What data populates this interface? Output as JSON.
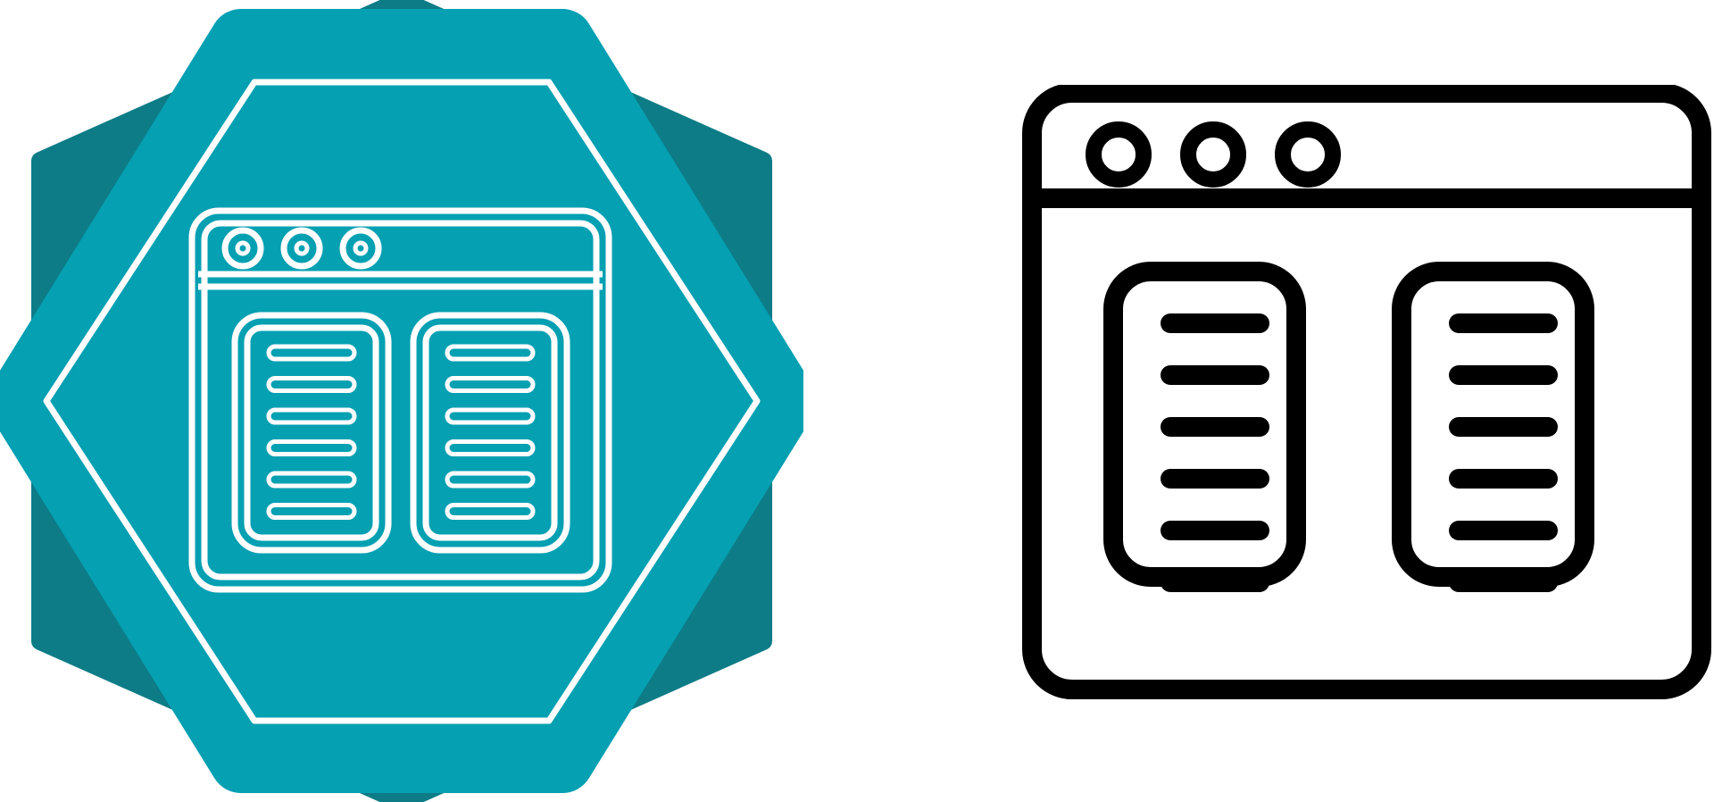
{
  "icons": [
    {
      "name": "browser-two-columns-icon",
      "style": "badge",
      "colors": {
        "badge_light": "#05a0b2",
        "badge_dark": "#0d7c86",
        "stroke": "#ffffff"
      }
    },
    {
      "name": "browser-two-columns-icon",
      "style": "outline",
      "colors": {
        "stroke": "#000000",
        "fill": "#ffffff"
      }
    }
  ],
  "panel_line_count": 6,
  "window_dot_count": 3
}
